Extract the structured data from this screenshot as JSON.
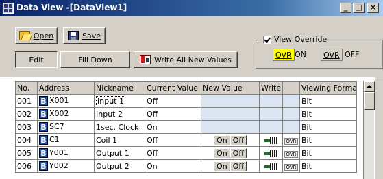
{
  "window": {
    "title": "Data View -[DataView1]",
    "min_label": "_",
    "max_label": "□",
    "close_label": "×"
  },
  "toolbar": {
    "open_label": "Open",
    "save_label": "Save",
    "edit_label": "Edit",
    "fill_down_label": "Fill Down",
    "write_all_label": "Write All New Values"
  },
  "override": {
    "label": "View Override",
    "checked": true,
    "ovr_on_badge": "OVR",
    "on_label": "ON",
    "ovr_off_badge": "OVR",
    "off_label": "OFF"
  },
  "table": {
    "columns": [
      "No.",
      "Address",
      "Nickname",
      "Current Value",
      "New Value",
      "Write",
      "",
      "Viewing Format"
    ],
    "rows": [
      {
        "no": "001",
        "type": "B",
        "address": "X001",
        "nickname": "Input 1",
        "current": "Off",
        "format": "Bit"
      },
      {
        "no": "002",
        "type": "B",
        "address": "X002",
        "nickname": "Input 2",
        "current": "Off",
        "format": "Bit"
      },
      {
        "no": "003",
        "type": "B",
        "address": "SC7",
        "nickname": "1sec. Clock",
        "current": "On",
        "format": "Bit"
      },
      {
        "no": "004",
        "type": "B",
        "address": "C1",
        "nickname": "Coil 1",
        "current": "Off",
        "format": "Bit",
        "on_btn": "On",
        "off_btn": "Off",
        "ovr": "OVR"
      },
      {
        "no": "005",
        "type": "B",
        "address": "Y001",
        "nickname": "Output 1",
        "current": "Off",
        "format": "Bit",
        "on_btn": "On",
        "off_btn": "Off",
        "ovr": "OVR"
      },
      {
        "no": "006",
        "type": "B",
        "address": "Y002",
        "nickname": "Output 2",
        "current": "On",
        "format": "Bit",
        "on_btn": "On",
        "off_btn": "Off",
        "ovr": "OVR"
      }
    ]
  }
}
